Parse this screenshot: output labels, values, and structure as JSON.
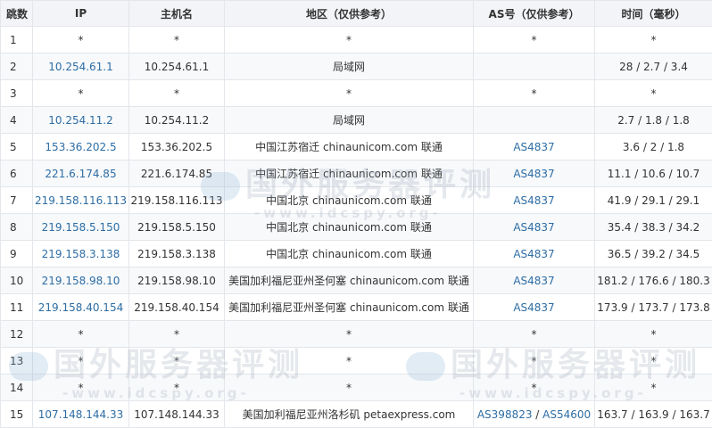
{
  "headers": [
    "跳数",
    "IP",
    "主机名",
    "地区（仅供参考）",
    "AS号（仅供参考）",
    "时间（毫秒）"
  ],
  "rows": [
    {
      "hop": "1",
      "ip": "*",
      "host": "*",
      "region": "*",
      "as": [
        "*"
      ],
      "time": "*"
    },
    {
      "hop": "2",
      "ip": "10.254.61.1",
      "host": "10.254.61.1",
      "region": "局域网",
      "as": [],
      "time": "28 / 2.7 / 3.4"
    },
    {
      "hop": "3",
      "ip": "*",
      "host": "*",
      "region": "*",
      "as": [
        "*"
      ],
      "time": "*"
    },
    {
      "hop": "4",
      "ip": "10.254.11.2",
      "host": "10.254.11.2",
      "region": "局域网",
      "as": [],
      "time": "2.7 / 1.8 / 1.8"
    },
    {
      "hop": "5",
      "ip": "153.36.202.5",
      "host": "153.36.202.5",
      "region": "中国江苏宿迁 chinaunicom.com 联通",
      "as": [
        "AS4837"
      ],
      "time": "3.6 / 2 / 1.8"
    },
    {
      "hop": "6",
      "ip": "221.6.174.85",
      "host": "221.6.174.85",
      "region": "中国江苏宿迁 chinaunicom.com 联通",
      "as": [
        "AS4837"
      ],
      "time": "11.1 / 10.6 / 10.7"
    },
    {
      "hop": "7",
      "ip": "219.158.116.113",
      "host": "219.158.116.113",
      "region": "中国北京 chinaunicom.com 联通",
      "as": [
        "AS4837"
      ],
      "time": "41.9 / 29.1 / 29.1"
    },
    {
      "hop": "8",
      "ip": "219.158.5.150",
      "host": "219.158.5.150",
      "region": "中国北京 chinaunicom.com 联通",
      "as": [
        "AS4837"
      ],
      "time": "35.4 / 38.3 / 34.2"
    },
    {
      "hop": "9",
      "ip": "219.158.3.138",
      "host": "219.158.3.138",
      "region": "中国北京 chinaunicom.com 联通",
      "as": [
        "AS4837"
      ],
      "time": "36.5 / 39.2 / 34.5"
    },
    {
      "hop": "10",
      "ip": "219.158.98.10",
      "host": "219.158.98.10",
      "region": "美国加利福尼亚州圣何塞 chinaunicom.com 联通",
      "as": [
        "AS4837"
      ],
      "time": "181.2 / 176.6 / 180.3"
    },
    {
      "hop": "11",
      "ip": "219.158.40.154",
      "host": "219.158.40.154",
      "region": "美国加利福尼亚州圣何塞 chinaunicom.com 联通",
      "as": [
        "AS4837"
      ],
      "time": "173.9 / 173.7 / 173.8"
    },
    {
      "hop": "12",
      "ip": "*",
      "host": "*",
      "region": "*",
      "as": [
        "*"
      ],
      "time": "*"
    },
    {
      "hop": "13",
      "ip": "*",
      "host": "*",
      "region": "*",
      "as": [
        "*"
      ],
      "time": "*"
    },
    {
      "hop": "14",
      "ip": "*",
      "host": "*",
      "region": "*",
      "as": [
        "*"
      ],
      "time": "*"
    },
    {
      "hop": "15",
      "ip": "107.148.144.33",
      "host": "107.148.144.33",
      "region": "美国加利福尼亚州洛杉矶 petaexpress.com",
      "as": [
        "AS398823",
        "AS54600"
      ],
      "time": "163.7 / 163.9 / 163.7"
    }
  ],
  "watermark": {
    "title": "国外服务器评测",
    "url": "-www.idcspy.org-"
  }
}
